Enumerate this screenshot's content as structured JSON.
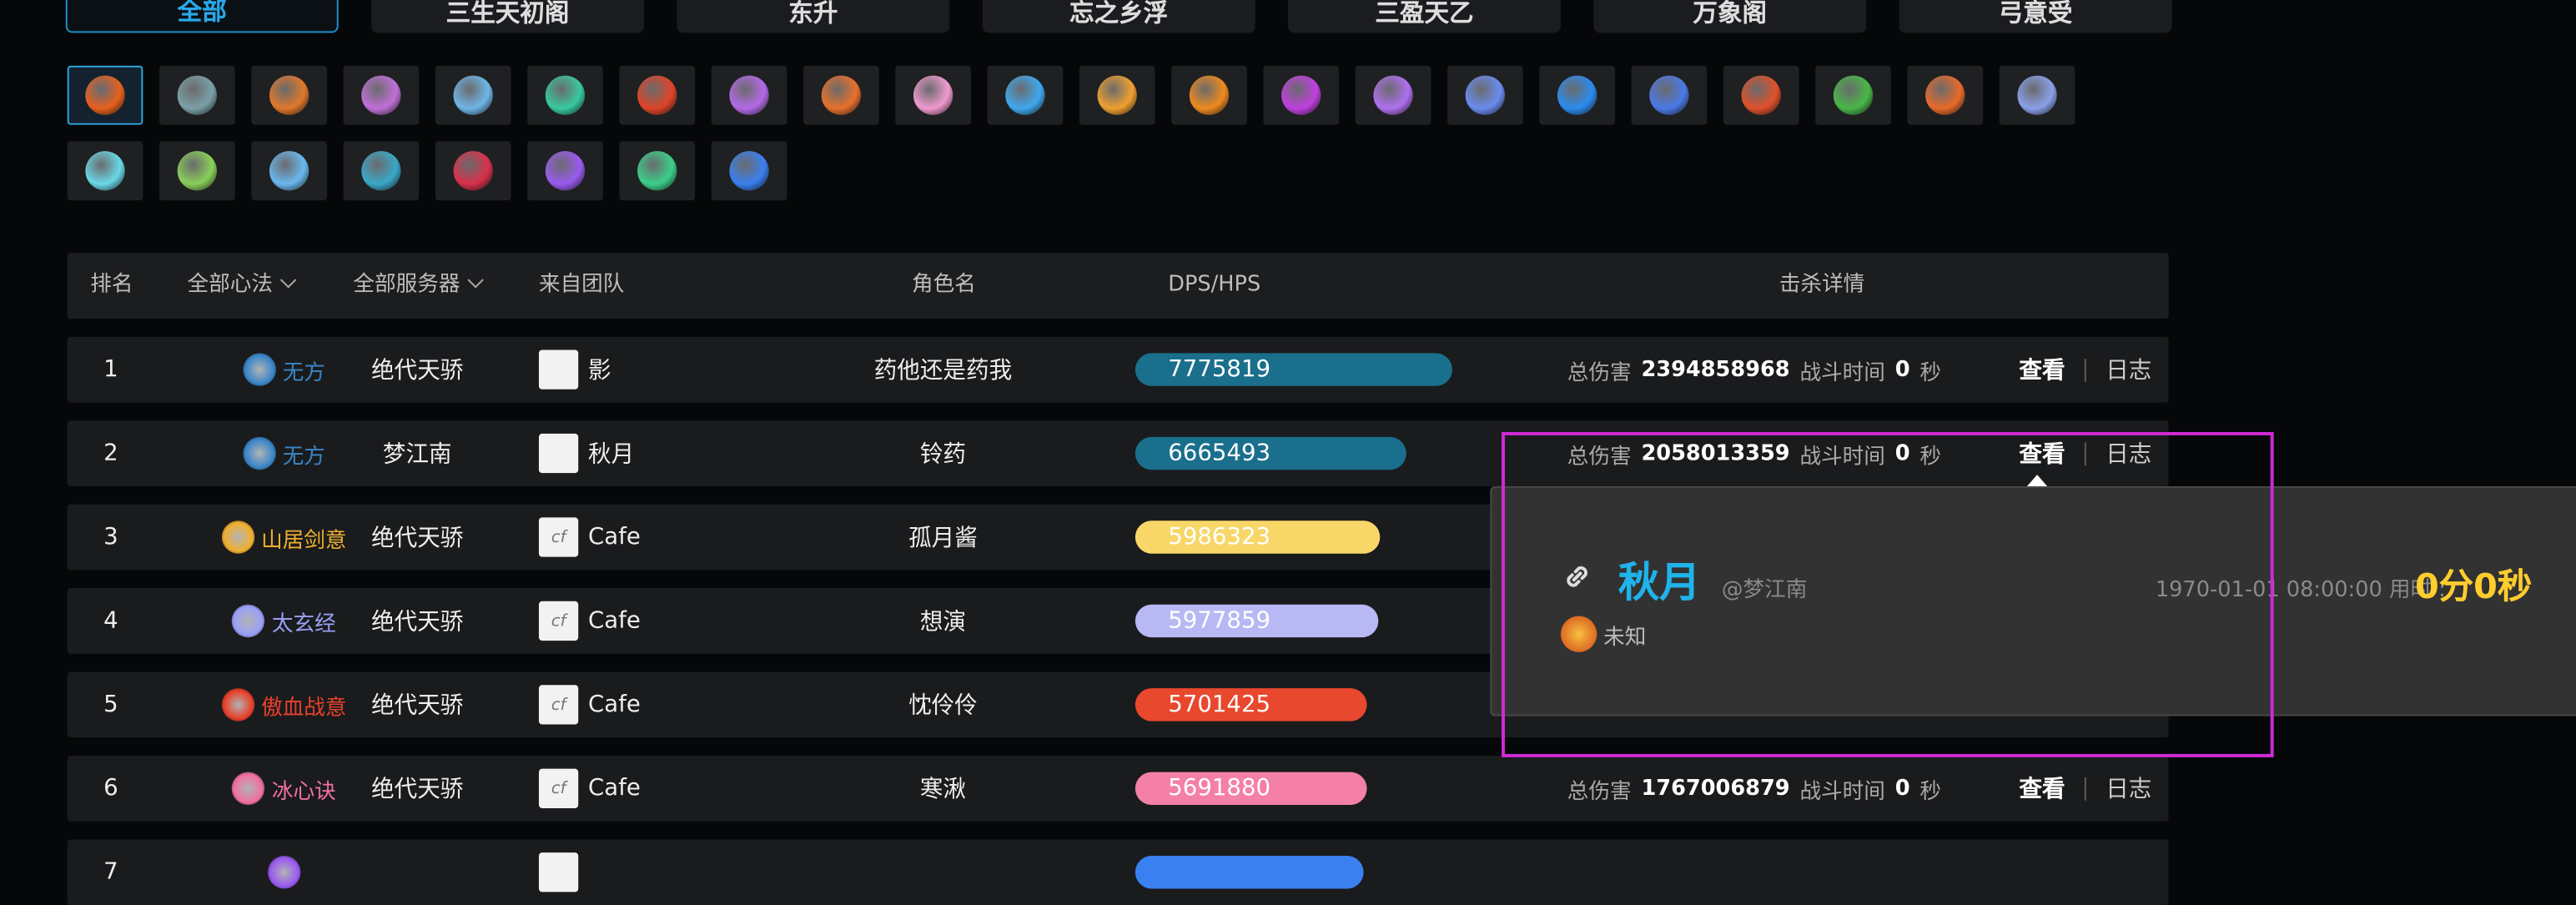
{
  "tabs": [
    "全部",
    "三生天初阁",
    "东升",
    "忘之乡浮",
    "三盈天乙",
    "万象阁",
    "弓意受"
  ],
  "skill_icons": [
    {
      "icon": "flame-feather-icon",
      "color": "#e8601c"
    },
    {
      "icon": "scroll-icon",
      "color": "#7aa0a8"
    },
    {
      "icon": "fire-crest-icon",
      "color": "#e0782a"
    },
    {
      "icon": "purple-mask-icon",
      "color": "#c070d8"
    },
    {
      "icon": "wind-swirl-icon",
      "color": "#6fb6e8"
    },
    {
      "icon": "green-warrior-icon",
      "color": "#38c9a0"
    },
    {
      "icon": "blood-demon-icon",
      "color": "#e04428"
    },
    {
      "icon": "violet-figure-icon",
      "color": "#b46ae8"
    },
    {
      "icon": "fire-beast-icon",
      "color": "#e8702a"
    },
    {
      "icon": "pink-lotus-icon",
      "color": "#f09ad0"
    },
    {
      "icon": "ice-crystal-icon",
      "color": "#3ea8f0"
    },
    {
      "icon": "golden-slash-icon",
      "color": "#f0a030"
    },
    {
      "icon": "mountain-flame-icon",
      "color": "#f08a1e"
    },
    {
      "icon": "purple-orb-icon",
      "color": "#c040e0"
    },
    {
      "icon": "violet-cone-icon",
      "color": "#b070f0"
    },
    {
      "icon": "blue-spiral-icon",
      "color": "#6a8cf0"
    },
    {
      "icon": "blue-flame-icon",
      "color": "#2a8cf0"
    },
    {
      "icon": "blue-wing-icon",
      "color": "#4a7ae8"
    },
    {
      "icon": "red-ember-icon",
      "color": "#e0502a"
    },
    {
      "icon": "green-fist-icon",
      "color": "#48b848"
    },
    {
      "icon": "orange-shield-icon",
      "color": "#e86a2a"
    },
    {
      "icon": "silver-sword-icon",
      "color": "#8aa0e8"
    },
    {
      "icon": "cyan-blade-icon",
      "color": "#6ad8e8"
    },
    {
      "icon": "green-leaf-icon",
      "color": "#8ad05a"
    },
    {
      "icon": "ice-shard-icon",
      "color": "#6ab8f0"
    },
    {
      "icon": "teal-moon-icon",
      "color": "#3aa8c8"
    },
    {
      "icon": "crimson-arc-icon",
      "color": "#d8304a"
    },
    {
      "icon": "dark-vortex-icon",
      "color": "#9a5af0"
    },
    {
      "icon": "emerald-seed-icon",
      "color": "#3ad08a"
    },
    {
      "icon": "blue-drop-icon",
      "color": "#3a80f0"
    }
  ],
  "table": {
    "headers": {
      "rank": "排名",
      "school": "全部心法",
      "server": "全部服务器",
      "team": "来自团队",
      "role": "角色名",
      "dps": "DPS/HPS",
      "detail": "击杀详情"
    },
    "labels": {
      "total_damage": "总伤害",
      "battle_time": "战斗时间",
      "seconds": "秒",
      "view": "查看",
      "sep": "|",
      "log": "日志"
    },
    "rows": [
      {
        "rank": "1",
        "school": "无方",
        "school_color": "#3a86c8",
        "server": "绝代天骄",
        "team": "影",
        "role": "药他还是药我",
        "dps": "7775819",
        "dps_fraction": 1.0,
        "bar_color": "#1a6f8c",
        "damage": "2394858968",
        "time": "0"
      },
      {
        "rank": "2",
        "school": "无方",
        "school_color": "#3a86c8",
        "server": "梦江南",
        "team": "秋月",
        "role": "铃药",
        "dps": "6665493",
        "dps_fraction": 0.857,
        "bar_color": "#1a6f8c",
        "damage": "2058013359",
        "time": "0"
      },
      {
        "rank": "3",
        "school": "山居剑意",
        "school_color": "#f0b030",
        "server": "绝代天骄",
        "team": "Cafe",
        "role": "孤月酱",
        "dps": "5986323",
        "dps_fraction": 0.77,
        "bar_color": "#f8d668",
        "damage": "",
        "time": ""
      },
      {
        "rank": "4",
        "school": "太玄经",
        "school_color": "#9aa0f8",
        "server": "绝代天骄",
        "team": "Cafe",
        "role": "想演",
        "dps": "5977859",
        "dps_fraction": 0.769,
        "bar_color": "#b8b8f4",
        "damage": "",
        "time": ""
      },
      {
        "rank": "5",
        "school": "傲血战意",
        "school_color": "#e8402a",
        "server": "绝代天骄",
        "team": "Cafe",
        "role": "忱伶伶",
        "dps": "5701425",
        "dps_fraction": 0.733,
        "bar_color": "#e8482e",
        "damage": "",
        "time": ""
      },
      {
        "rank": "6",
        "school": "冰心诀",
        "school_color": "#f070a0",
        "server": "绝代天骄",
        "team": "Cafe",
        "role": "寒湫",
        "dps": "5691880",
        "dps_fraction": 0.732,
        "bar_color": "#f480a8",
        "damage": "1767006879",
        "time": "0"
      },
      {
        "rank": "7",
        "school": "",
        "school_color": "#9a5af0",
        "server": "",
        "team": "",
        "role": "",
        "dps": "",
        "dps_fraction": 0.72,
        "bar_color": "#3a80f0",
        "damage": "",
        "time": ""
      }
    ]
  },
  "popover": {
    "name": "秋月",
    "server": "@梦江南",
    "datetime": "1970-01-01 08:00:00 用时 :",
    "duration": "0分0秒",
    "status": "未知"
  }
}
